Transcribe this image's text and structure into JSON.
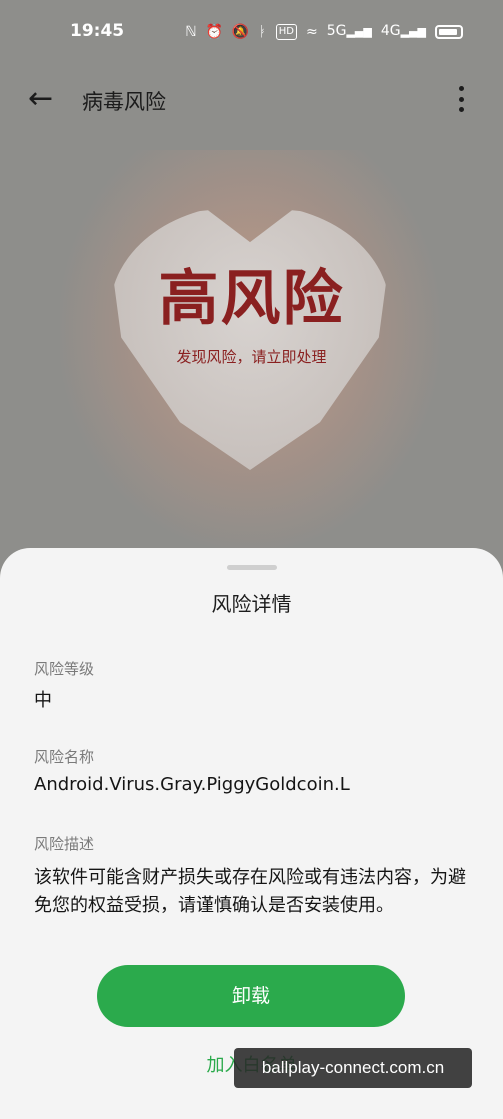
{
  "status_bar": {
    "time": "19:45",
    "icons": [
      "nfc-icon",
      "alarm-icon",
      "mute-icon",
      "bluetooth-icon",
      "hd-icon",
      "wifi-icon",
      "5g-signal-icon",
      "4g-signal-icon",
      "battery-icon"
    ],
    "hd_label": "HD",
    "signal1_label": "5G",
    "signal2_label": "4G"
  },
  "app_bar": {
    "title": "病毒风险",
    "back_icon": "arrow-left-icon",
    "more_icon": "more-vertical-icon"
  },
  "hero": {
    "risk_level_title": "高风险",
    "risk_subtitle": "发现风险，请立即处理",
    "accent_color": "#8a2020"
  },
  "sheet": {
    "title": "风险详情",
    "fields": [
      {
        "label": "风险等级",
        "value": "中"
      },
      {
        "label": "风险名称",
        "value": "Android.Virus.Gray.PiggyGoldcoin.L"
      },
      {
        "label": "风险描述",
        "value": "该软件可能含财产损失或存在风险或有违法内容，为避免您的权益受损，请谨慎确认是否安装使用。"
      }
    ],
    "primary_button": "卸载",
    "secondary_link": "加入白名单",
    "primary_color": "#2baa4c"
  },
  "watermark": {
    "text": "ballplay-connect.com.cn"
  }
}
